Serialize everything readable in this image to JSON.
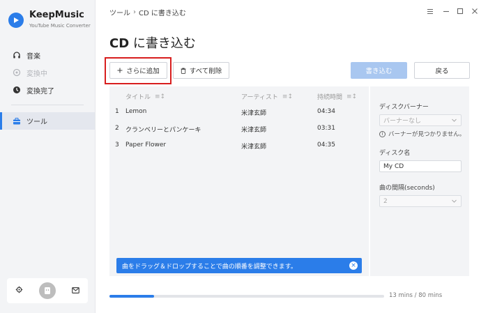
{
  "app": {
    "name": "KeepMusic",
    "subtitle": "YouTube Music Converter"
  },
  "sidebar": {
    "items": [
      {
        "label": "音楽",
        "icon": "headphones-icon",
        "state": "normal"
      },
      {
        "label": "変換中",
        "icon": "converting-icon",
        "state": "disabled"
      },
      {
        "label": "変換完了",
        "icon": "clock-icon",
        "state": "normal"
      },
      {
        "label": "ツール",
        "icon": "toolbox-icon",
        "state": "active"
      }
    ],
    "footer_icons": [
      "settings-icon",
      "avatar",
      "mail-icon"
    ]
  },
  "header": {
    "breadcrumb": [
      "ツール",
      "CD に書き込む"
    ],
    "window_controls": [
      "menu-icon",
      "minimize-icon",
      "maximize-icon",
      "close-icon"
    ]
  },
  "page": {
    "title_bold": "CD",
    "title_rest": " に書き込む"
  },
  "toolbar": {
    "add_more": "さらに追加",
    "delete_all": "すべて削除",
    "burn": "書き込む",
    "back": "戻る"
  },
  "table": {
    "columns": [
      "タイトル",
      "アーティスト",
      "持続時間"
    ],
    "rows": [
      {
        "no": "1",
        "title": "Lemon",
        "artist": "米津玄師",
        "duration": "04:34"
      },
      {
        "no": "2",
        "title": "クランベリーとパンケーキ",
        "artist": "米津玄師",
        "duration": "03:31"
      },
      {
        "no": "3",
        "title": "Paper Flower",
        "artist": "米津玄師",
        "duration": "04:35"
      }
    ]
  },
  "notice": {
    "text": "曲をドラッグ＆ドロップすることで曲の順番を調整できます。"
  },
  "disc": {
    "banner_label": "ディスクバーナー",
    "banner_value": "バーナーなし",
    "banner_hint": "バーナーが見つかりません。",
    "name_label": "ディスク名",
    "name_value": "My CD",
    "gap_label": "曲の間隔(seconds)",
    "gap_value": "2"
  },
  "progress": {
    "fraction": 0.1625,
    "text": "13 mins / 80 mins"
  },
  "colors": {
    "accent": "#2b7de9",
    "highlight": "#d81e1e",
    "sidebar_bg": "#f3f4f6"
  }
}
